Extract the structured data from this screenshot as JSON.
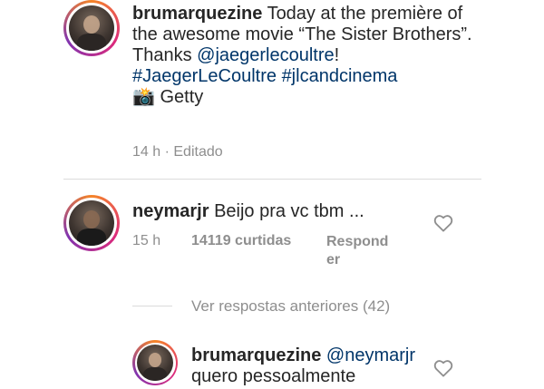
{
  "post": {
    "username": "brumarquezine",
    "caption_text": "Today at the première of the awesome movie “The Sister Brothers”. Thanks",
    "mention": "@jaegerlecoultre",
    "exclaim": "!",
    "hashtag1": "#JaegerLeCoultre",
    "hashtag2": "#jlcandcinema",
    "camera_emoji": "📸",
    "credit": "Getty",
    "time": "14 h",
    "separator": "·",
    "edited": "Editado"
  },
  "comment": {
    "username": "neymarjr",
    "text": "Beijo pra vc tbm ...",
    "time": "15 h",
    "likes": "14119 curtidas",
    "reply_line1": "Respond",
    "reply_line2": "er",
    "heart_icon": "heart-outline-icon"
  },
  "replies_toggle": {
    "label": "Ver respostas anteriores (42)"
  },
  "reply": {
    "username": "brumarquezine",
    "mention": "@neymarjr",
    "text": "quero pessoalmente",
    "heart_icon": "heart-outline-icon"
  },
  "colors": {
    "link": "#003569",
    "meta": "#8e8e8e",
    "text": "#262626"
  }
}
